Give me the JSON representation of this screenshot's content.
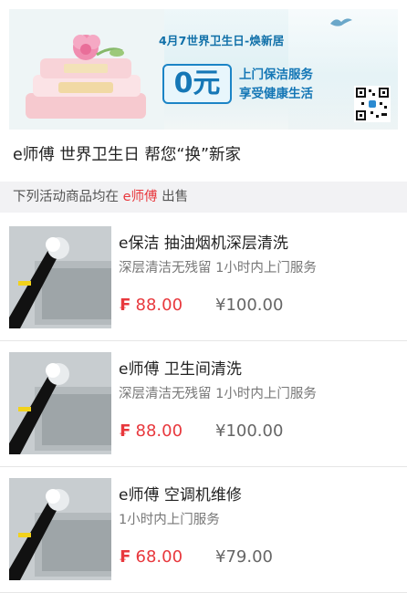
{
  "banner": {
    "date_line": "4月7世界卫生日-焕新居",
    "zero_price": "0元",
    "promo_line1": "上门保洁服务",
    "promo_line2": "享受健康生活",
    "accent_color": "#1577b6"
  },
  "page_title": "e师傅 世界卫生日 帮您“换”新家",
  "notice": {
    "prefix": "下列活动商品均在",
    "brand": "e师傅",
    "suffix": "出售"
  },
  "products": [
    {
      "name": "e保洁 抽油烟机深层清洗",
      "desc": "深层清洁无残留   1小时内上门服务",
      "currency_icon": "yuan-icon",
      "price": "88.00",
      "original_price": "¥100.00"
    },
    {
      "name": "e师傅 卫生间清洗",
      "desc": "深层清洁无残留   1小时内上门服务",
      "currency_icon": "yuan-icon",
      "price": "88.00",
      "original_price": "¥100.00"
    },
    {
      "name": "e师傅 空调机维修",
      "desc": "1小时内上门服务",
      "currency_icon": "yuan-icon",
      "price": "68.00",
      "original_price": "¥79.00"
    }
  ],
  "colors": {
    "price_red": "#e8383d",
    "notice_bg": "#f2f2f4"
  }
}
